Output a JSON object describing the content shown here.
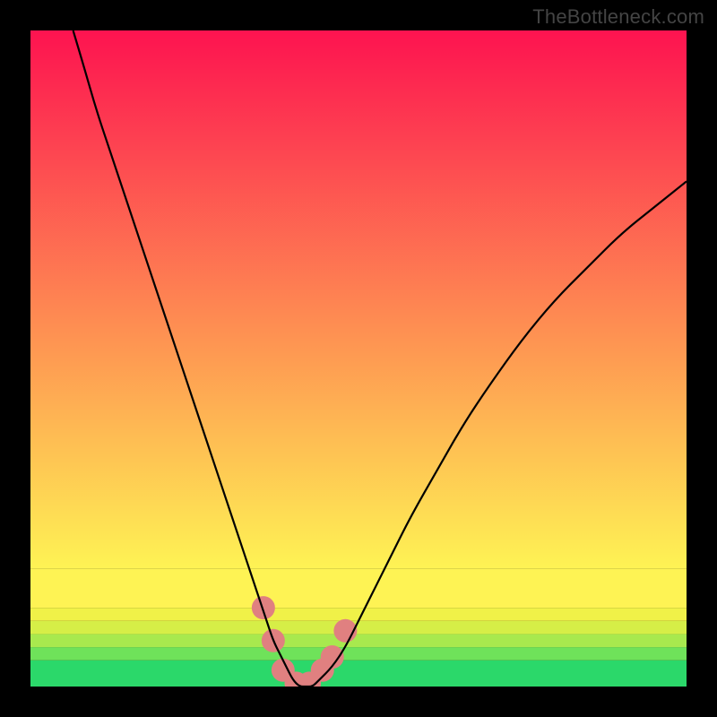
{
  "watermark": "TheBottleneck.com",
  "chart_data": {
    "type": "line",
    "title": "",
    "xlabel": "",
    "ylabel": "",
    "xlim": [
      0,
      100
    ],
    "ylim": [
      0,
      100
    ],
    "series": [
      {
        "name": "bottleneck-curve",
        "x": [
          6.5,
          8,
          10,
          12,
          14,
          16,
          18,
          20,
          22,
          24,
          26,
          28,
          30,
          32,
          33,
          34,
          35,
          36,
          37,
          38,
          39,
          40,
          41,
          42,
          43,
          44,
          46,
          48,
          50,
          52,
          55,
          58,
          62,
          66,
          70,
          75,
          80,
          85,
          90,
          95,
          100
        ],
        "values": [
          100,
          95,
          88,
          82,
          76,
          70,
          64,
          58,
          52,
          46,
          40,
          34,
          28,
          22,
          19,
          16,
          13,
          10,
          7,
          5,
          3,
          1,
          0,
          0,
          0,
          1,
          3,
          6,
          10,
          14,
          20,
          26,
          33,
          40,
          46,
          53,
          59,
          64,
          69,
          73,
          77
        ]
      }
    ],
    "markers": [
      {
        "x": 35.5,
        "y": 12
      },
      {
        "x": 37.0,
        "y": 7
      },
      {
        "x": 38.5,
        "y": 2.5
      },
      {
        "x": 40.5,
        "y": 0.5
      },
      {
        "x": 42.5,
        "y": 0.5
      },
      {
        "x": 44.5,
        "y": 2.5
      },
      {
        "x": 46.0,
        "y": 4.5
      },
      {
        "x": 48.0,
        "y": 8.5
      }
    ],
    "bands": [
      {
        "y0": 0,
        "y1": 4,
        "color": "#2bd86a"
      },
      {
        "y0": 4,
        "y1": 6,
        "color": "#6fe25a"
      },
      {
        "y0": 6,
        "y1": 8,
        "color": "#a8e94e"
      },
      {
        "y0": 8,
        "y1": 10,
        "color": "#d6ee47"
      },
      {
        "y0": 10,
        "y1": 12,
        "color": "#f0f148"
      },
      {
        "y0": 12,
        "y1": 18,
        "color": "#fef354"
      }
    ],
    "gradient_start": "#fd1350",
    "gradient_end": "#fef354",
    "marker_color": "#e08080",
    "curve_color": "#000000",
    "frame_color": "#000000"
  }
}
